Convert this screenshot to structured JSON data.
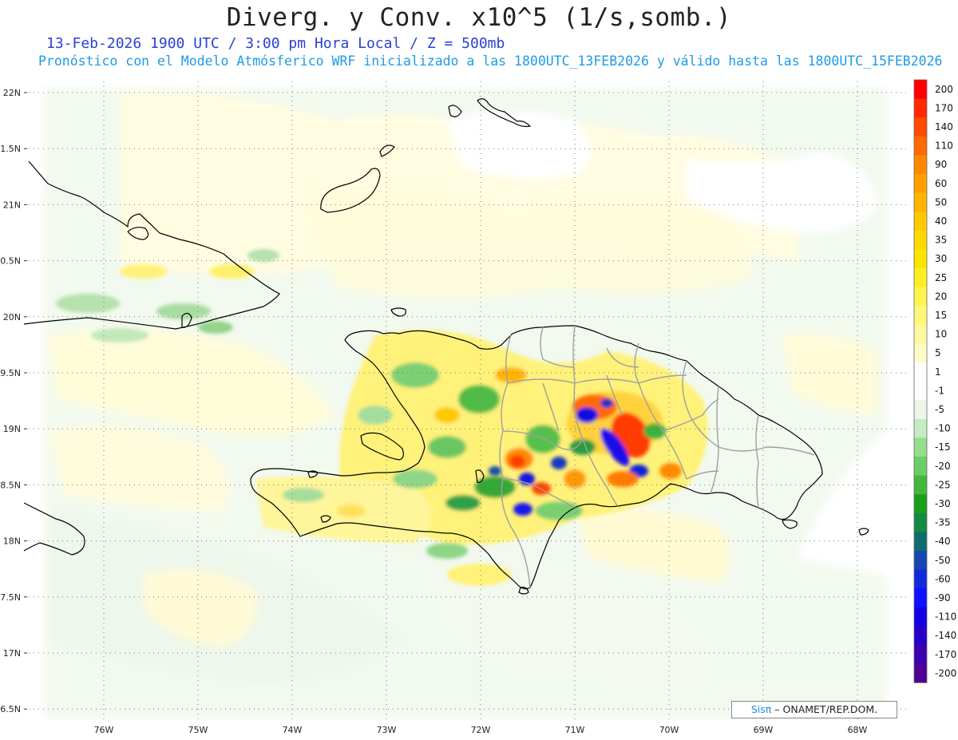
{
  "title": "Diverg. y Conv. x10^5 (1/s,somb.)",
  "subtitle_1": "13-Feb-2026  1900 UTC / 3:00 pm Hora Local / Z = 500mb",
  "subtitle_2": "Pronóstico con el Modelo Atmósferico WRF inicializado a las 1800UTC_13FEB2026 y válido hasta las  1800UTC_15FEB2026",
  "axes": {
    "lon_labels": [
      "76W",
      "75W",
      "74W",
      "73W",
      "72W",
      "71W",
      "70W",
      "69W",
      "68W"
    ],
    "lat_labels": [
      "22N",
      "1.5N",
      "21N",
      "0.5N",
      "20N",
      "9.5N",
      "19N",
      "8.5N",
      "18N",
      "7.5N",
      "17N",
      "6.5N"
    ],
    "grid": "dotted"
  },
  "colorbar": {
    "levels": [
      "200",
      "170",
      "140",
      "110",
      "90",
      "60",
      "50",
      "40",
      "35",
      "30",
      "25",
      "20",
      "15",
      "10",
      "5",
      "1",
      "-1",
      "-5",
      "-10",
      "-15",
      "-20",
      "-25",
      "-30",
      "-35",
      "-40",
      "-50",
      "-60",
      "-90",
      "-110",
      "-140",
      "-170",
      "-200"
    ],
    "colors": [
      "#ff0000",
      "#ff2a00",
      "#ff4a00",
      "#ff6a00",
      "#ff8800",
      "#ffa000",
      "#ffb400",
      "#ffc800",
      "#ffd800",
      "#ffe400",
      "#ffee22",
      "#fff44c",
      "#fff878",
      "#fffaa0",
      "#fffcc8",
      "#ffffff",
      "#ffffff",
      "#eef6ea",
      "#c4ecc0",
      "#98dc8e",
      "#6ccc66",
      "#44b83c",
      "#1aa01a",
      "#128a44",
      "#0e6e6e",
      "#1448b0",
      "#1428dc",
      "#1010ff",
      "#1400e6",
      "#2800c8",
      "#3c00b0",
      "#500096"
    ]
  },
  "credit": {
    "brand": "Sisπ",
    "text": "– ONAMET/REP.DOM."
  }
}
